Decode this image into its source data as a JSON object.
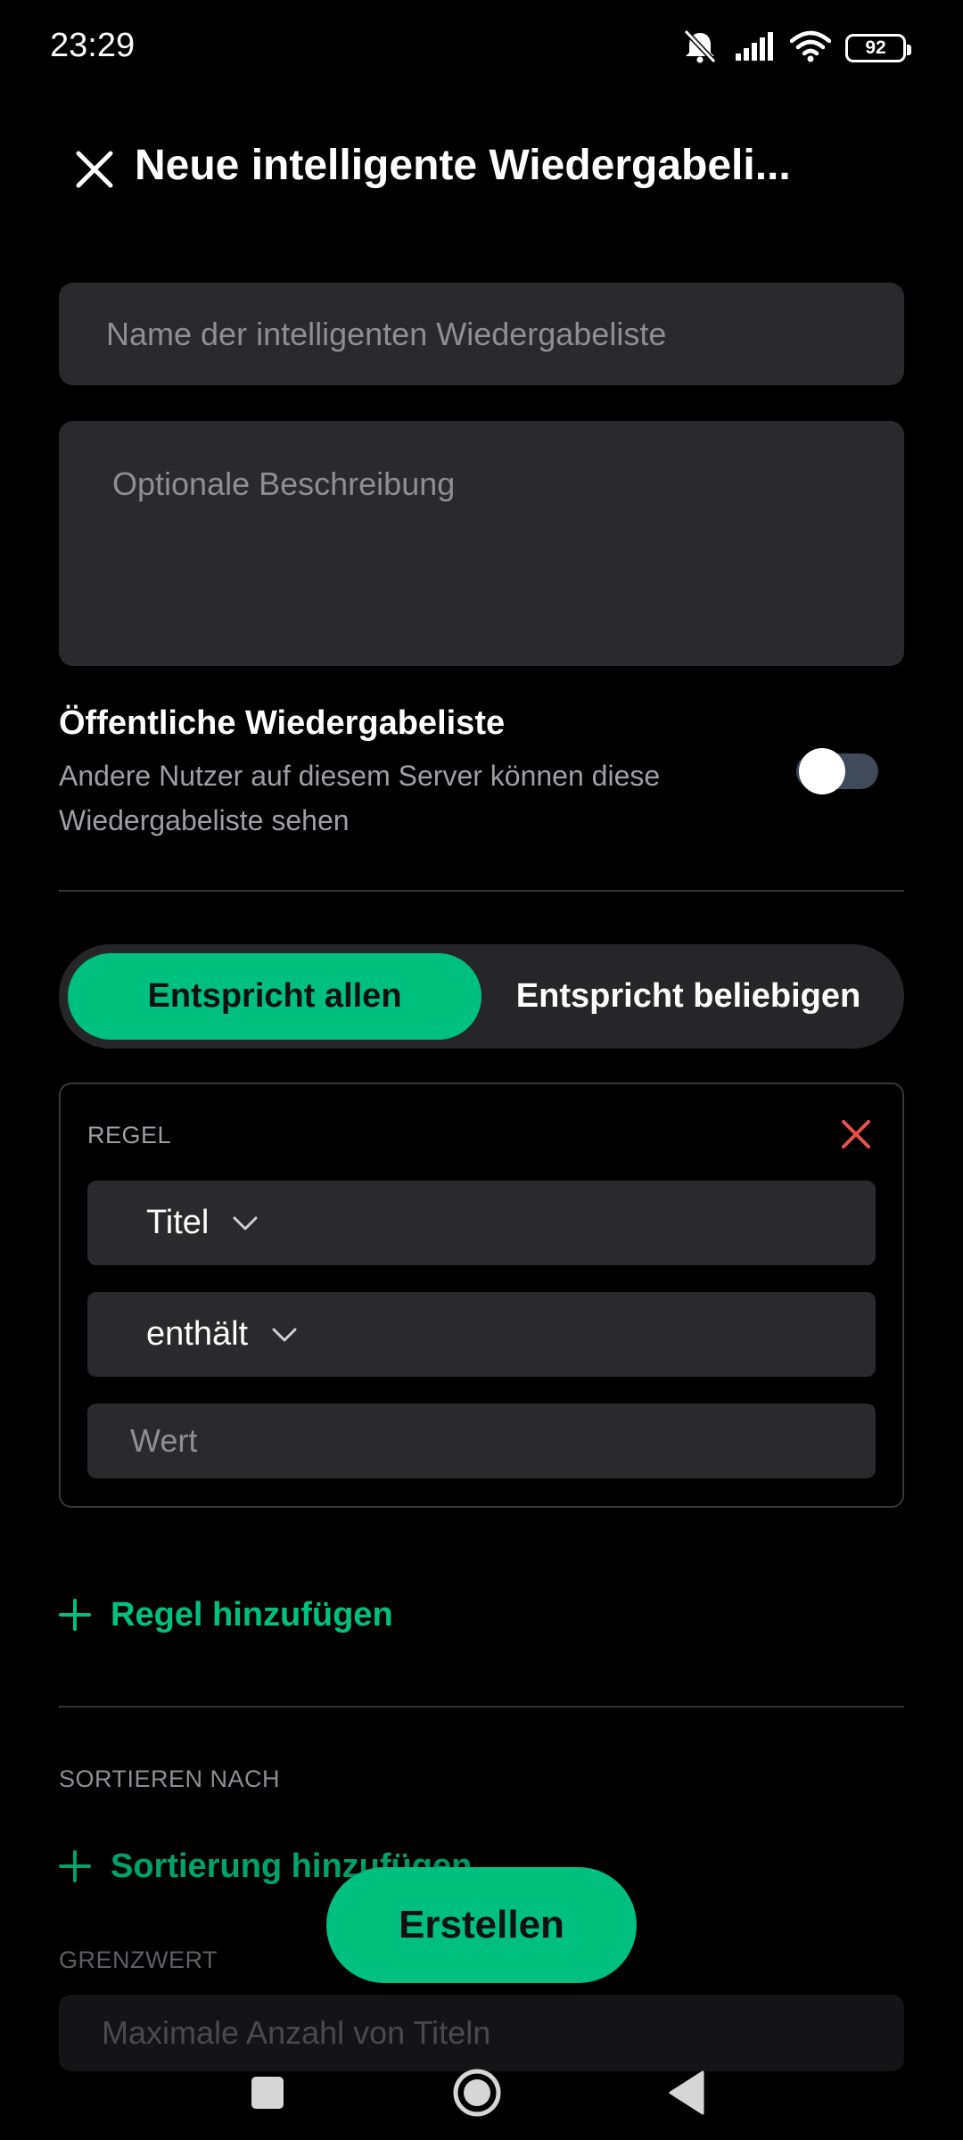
{
  "status_bar": {
    "time": "23:29",
    "battery": "92",
    "icons": [
      "muted-bell-icon",
      "signal-icon",
      "wifi-icon",
      "battery-icon"
    ]
  },
  "header": {
    "close_icon": "close-icon",
    "title": "Neue intelligente Wiedergabeli..."
  },
  "form": {
    "name_placeholder": "Name der intelligenten Wiedergabeliste",
    "name_value": "",
    "description_placeholder": "Optionale Beschreibung",
    "description_value": "",
    "public": {
      "title": "Öffentliche Wiedergabeliste",
      "description": "Andere Nutzer auf diesem Server können diese Wiedergabeliste sehen",
      "enabled": false
    },
    "match_mode": {
      "options": [
        "Entspricht allen",
        "Entspricht beliebigen"
      ],
      "selected": "Entspricht allen"
    },
    "rule": {
      "label": "REGEL",
      "field": "Titel",
      "operator": "enthält",
      "value_placeholder": "Wert",
      "value": ""
    },
    "add_rule_label": "Regel hinzufügen",
    "sort_label": "SORTIEREN NACH",
    "add_sort_label": "Sortierung hinzufügen",
    "limit_label": "GRENZWERT",
    "limit_placeholder": "Maximale Anzahl von Titeln",
    "limit_value": ""
  },
  "create_button_label": "Erstellen",
  "colors": {
    "accent": "#00c07f",
    "background": "#000000",
    "surface": "#2a2a2c",
    "danger": "#e5534b",
    "muted_text": "#9e9ea3"
  }
}
